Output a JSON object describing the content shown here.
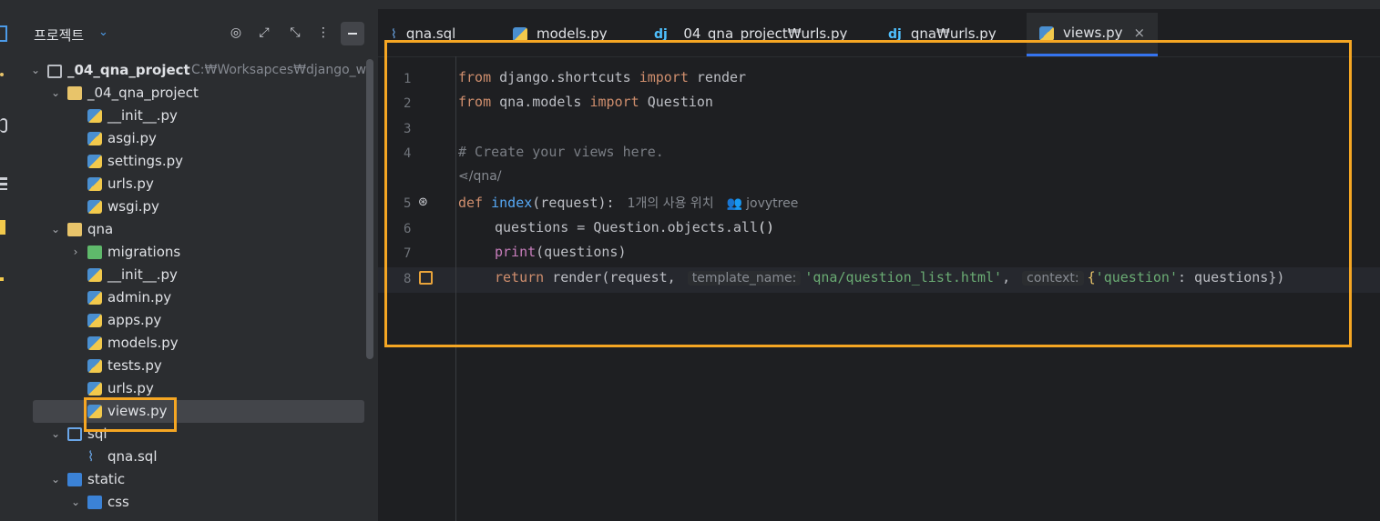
{
  "sidebar": {
    "title": "프로젝트",
    "tree": [
      {
        "label": "_04_qna_project",
        "hint": "C:₩Worksapces₩django_wo",
        "type": "project",
        "depth": 0,
        "expanded": true
      },
      {
        "label": "_04_qna_project",
        "type": "folder",
        "depth": 1,
        "expanded": true
      },
      {
        "label": "__init__.py",
        "type": "py",
        "depth": 2
      },
      {
        "label": "asgi.py",
        "type": "py",
        "depth": 2
      },
      {
        "label": "settings.py",
        "type": "py",
        "depth": 2
      },
      {
        "label": "urls.py",
        "type": "py",
        "depth": 2
      },
      {
        "label": "wsgi.py",
        "type": "py",
        "depth": 2
      },
      {
        "label": "qna",
        "type": "folder",
        "depth": 1,
        "expanded": true
      },
      {
        "label": "migrations",
        "type": "folder-green",
        "depth": 2,
        "expanded": false
      },
      {
        "label": "__init__.py",
        "type": "py",
        "depth": 2
      },
      {
        "label": "admin.py",
        "type": "py",
        "depth": 2
      },
      {
        "label": "apps.py",
        "type": "py",
        "depth": 2
      },
      {
        "label": "models.py",
        "type": "py",
        "depth": 2
      },
      {
        "label": "tests.py",
        "type": "py",
        "depth": 2
      },
      {
        "label": "urls.py",
        "type": "py",
        "depth": 2
      },
      {
        "label": "views.py",
        "type": "py",
        "depth": 2,
        "selected": true
      },
      {
        "label": "sql",
        "type": "folder-sql",
        "depth": 1,
        "expanded": true
      },
      {
        "label": "qna.sql",
        "type": "sql",
        "depth": 2
      },
      {
        "label": "static",
        "type": "folder-blue",
        "depth": 1,
        "expanded": true
      },
      {
        "label": "css",
        "type": "folder-blue",
        "depth": 2,
        "expanded": true
      }
    ]
  },
  "tabs": [
    {
      "label": "qna.sql",
      "icon": "sql-icon"
    },
    {
      "label": "models.py",
      "icon": "python-icon"
    },
    {
      "label": "_04_qna_project₩urls.py",
      "icon": "django-icon",
      "icon_text": "dj"
    },
    {
      "label": "qna₩urls.py",
      "icon": "django-icon",
      "icon_text": "dj"
    },
    {
      "label": "views.py",
      "icon": "python-icon",
      "active": true,
      "close": "×"
    }
  ],
  "editor": {
    "line_numbers": [
      "1",
      "2",
      "3",
      "4",
      "5",
      "6",
      "7",
      "8"
    ],
    "lines": {
      "l1": {
        "k1": "from",
        "t1": " django.shortcuts ",
        "k2": "import",
        "t2": " render"
      },
      "l2": {
        "k1": "from",
        "t1": " qna.models ",
        "k2": "import",
        "t2": " Question"
      },
      "l4": {
        "c": "# Create your views here."
      },
      "route": {
        "t": "/qna/"
      },
      "l5": {
        "k": "def",
        "f": " index",
        "p": "(request):",
        "usages": "1개의 사용 위치",
        "author": "jovytree"
      },
      "l6": {
        "t": "questions = Question.objects.all",
        "p": "()"
      },
      "l7": {
        "b": "print",
        "t": "(questions)"
      },
      "l8": {
        "k": "return",
        "t1": " render(request, ",
        "h1": "template_name:",
        "s1": "'qna/question_list.html'",
        "t2": ", ",
        "h2": "context:",
        "t3": "{",
        "s2": "'question'",
        "t4": ": questions})"
      }
    }
  },
  "colors": {
    "highlight": "#f5a623",
    "accent": "#3574f0"
  }
}
